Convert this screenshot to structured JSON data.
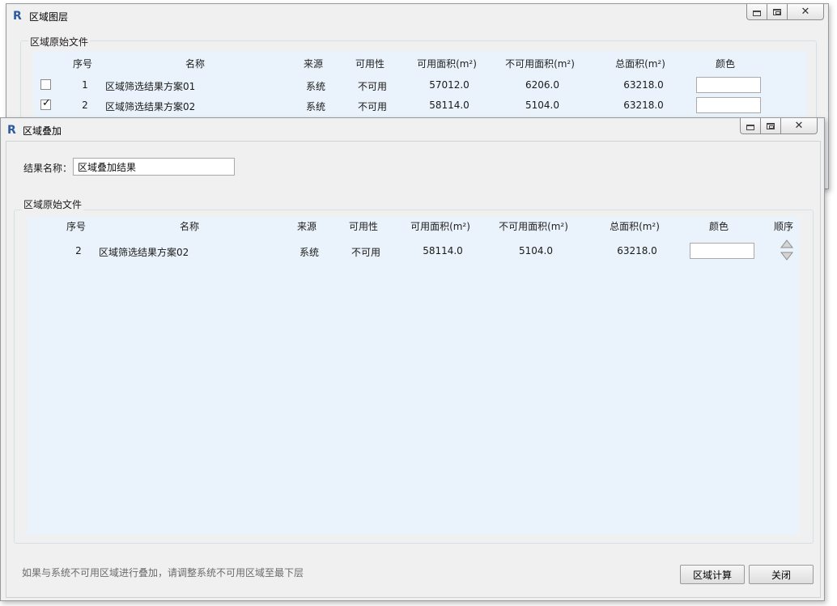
{
  "back_window": {
    "title": "区域图层",
    "group_title": "区域原始文件",
    "columns": [
      "序号",
      "名称",
      "来源",
      "可用性",
      "可用面积(m²)",
      "不可用面积(m²)",
      "总面积(m²)",
      "颜色"
    ],
    "rows": [
      {
        "checked": false,
        "index": "1",
        "name": "区域筛选结果方案01",
        "source": "系统",
        "availability": "不可用",
        "usable_area": "57012.0",
        "unusable_area": "6206.0",
        "total_area": "63218.0"
      },
      {
        "checked": true,
        "index": "2",
        "name": "区域筛选结果方案02",
        "source": "系统",
        "availability": "不可用",
        "usable_area": "58114.0",
        "unusable_area": "5104.0",
        "total_area": "63218.0"
      }
    ]
  },
  "front_window": {
    "title": "区域叠加",
    "result_name_label": "结果名称：",
    "result_name_value": "区域叠加结果",
    "group_title": "区域原始文件",
    "columns": [
      "序号",
      "名称",
      "来源",
      "可用性",
      "可用面积(m²)",
      "不可用面积(m²)",
      "总面积(m²)",
      "颜色",
      "顺序"
    ],
    "rows": [
      {
        "index": "2",
        "name": "区域筛选结果方案02",
        "source": "系统",
        "availability": "不可用",
        "usable_area": "58114.0",
        "unusable_area": "5104.0",
        "total_area": "63218.0"
      }
    ],
    "hint": "如果与系统不可用区域进行叠加，请调整系统不可用区域至最下层",
    "calc_button": "区域计算",
    "close_button": "关闭"
  },
  "app_icon_letter": "R",
  "colors": {
    "grid_bg": "#eaf3fb",
    "icon_blue": "#2c5aa0",
    "hint_gray": "#6b6b6b"
  }
}
